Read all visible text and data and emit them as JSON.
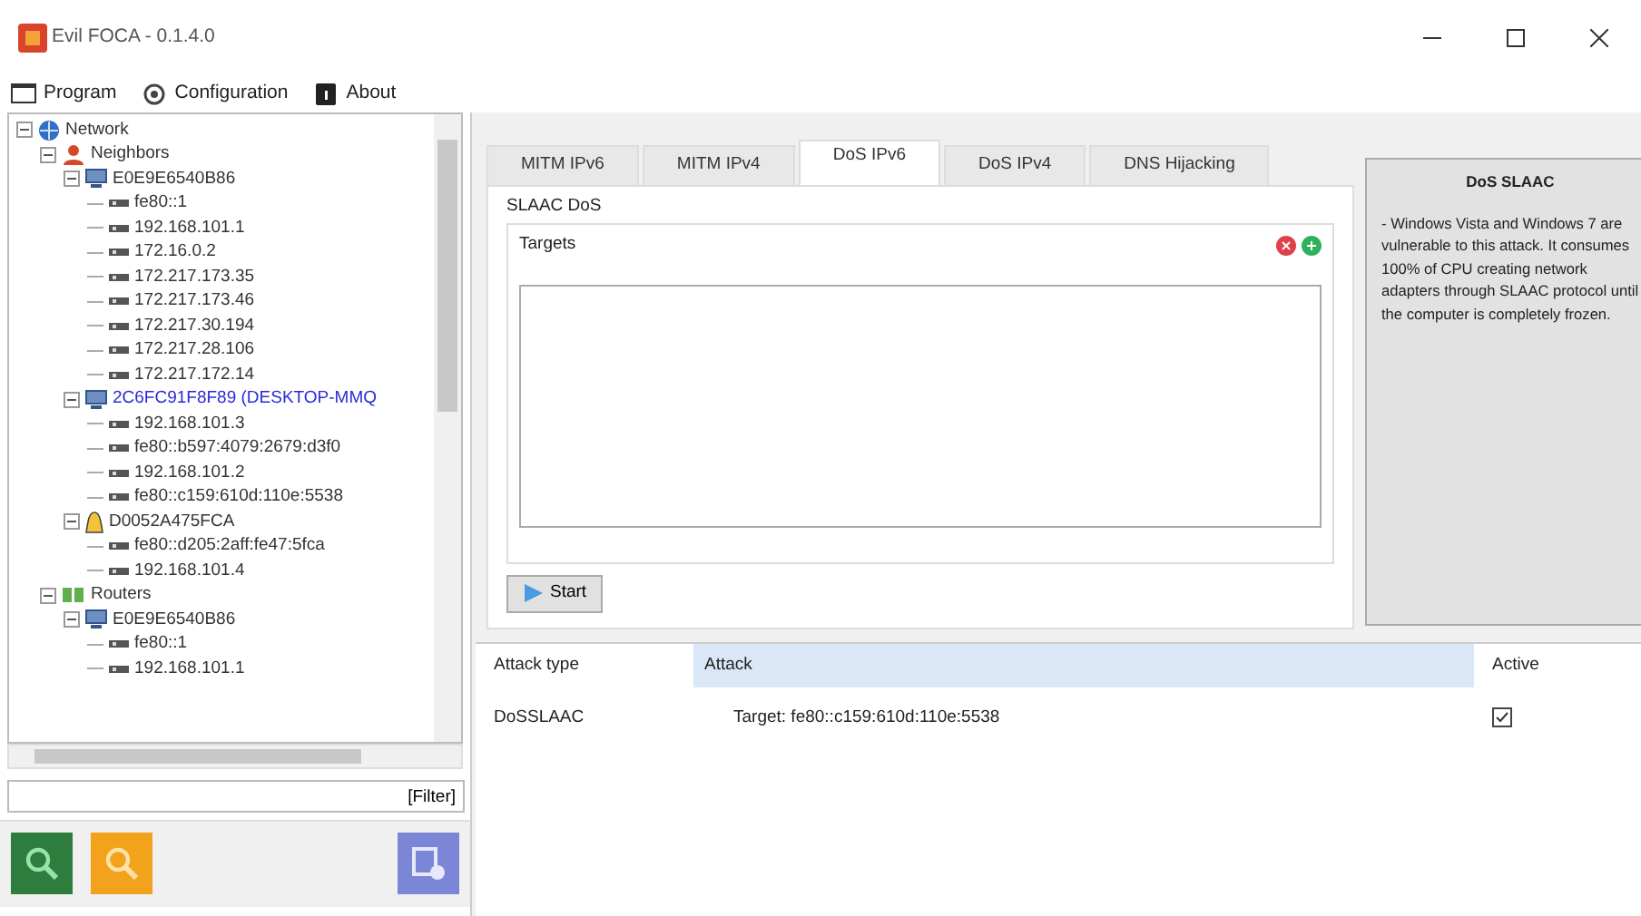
{
  "window": {
    "title": "Evil FOCA - 0.1.4.0"
  },
  "menu": [
    {
      "label": "Program",
      "kind": "program"
    },
    {
      "label": "Configuration",
      "kind": "config"
    },
    {
      "label": "About",
      "kind": "about"
    }
  ],
  "tree": [
    {
      "label": "Network",
      "kind": "network",
      "highlighted": false,
      "expanded": true,
      "children": [
        {
          "label": "Neighbors",
          "kind": "neighbors",
          "highlighted": false,
          "expanded": true,
          "children": [
            {
              "label": "E0E9E6540B86",
              "kind": "pc",
              "highlighted": false,
              "expanded": true,
              "children": [
                {
                  "label": "fe80::1",
                  "kind": "ip",
                  "highlighted": false
                },
                {
                  "label": "192.168.101.1",
                  "kind": "ip",
                  "highlighted": false
                },
                {
                  "label": "172.16.0.2",
                  "kind": "ip",
                  "highlighted": false
                },
                {
                  "label": "172.217.173.35",
                  "kind": "ip",
                  "highlighted": false
                },
                {
                  "label": "172.217.173.46",
                  "kind": "ip",
                  "highlighted": false
                },
                {
                  "label": "172.217.30.194",
                  "kind": "ip",
                  "highlighted": false
                },
                {
                  "label": "172.217.28.106",
                  "kind": "ip",
                  "highlighted": false
                },
                {
                  "label": "172.217.172.14",
                  "kind": "ip",
                  "highlighted": false
                }
              ]
            },
            {
              "label": "2C6FC91F8F89 (DESKTOP-MMQ",
              "kind": "pc",
              "highlighted": true,
              "expanded": true,
              "children": [
                {
                  "label": "192.168.101.3",
                  "kind": "ip",
                  "highlighted": false
                },
                {
                  "label": "fe80::b597:4079:2679:d3f0",
                  "kind": "ip",
                  "highlighted": false
                },
                {
                  "label": "192.168.101.2",
                  "kind": "ip",
                  "highlighted": false
                },
                {
                  "label": "fe80::c159:610d:110e:5538",
                  "kind": "ip",
                  "highlighted": false
                }
              ]
            },
            {
              "label": "D0052A475FCA",
              "kind": "linux",
              "highlighted": false,
              "expanded": true,
              "children": [
                {
                  "label": "fe80::d205:2aff:fe47:5fca",
                  "kind": "ip",
                  "highlighted": false
                },
                {
                  "label": "192.168.101.4",
                  "kind": "ip",
                  "highlighted": false
                }
              ]
            }
          ]
        },
        {
          "label": "Routers",
          "kind": "routers",
          "highlighted": false,
          "expanded": true,
          "children": [
            {
              "label": "E0E9E6540B86",
              "kind": "pc",
              "highlighted": false,
              "expanded": true,
              "children": [
                {
                  "label": "fe80::1",
                  "kind": "ip",
                  "highlighted": false
                },
                {
                  "label": "192.168.101.1",
                  "kind": "ip",
                  "highlighted": false
                }
              ]
            }
          ]
        }
      ]
    }
  ],
  "filter": {
    "value": "[Filter]"
  },
  "tools": [
    {
      "kind": "search-green"
    },
    {
      "kind": "search-orange"
    },
    {
      "kind": "monitor"
    }
  ],
  "tabs": [
    {
      "label": "MITM IPv6",
      "selected": false
    },
    {
      "label": "MITM IPv4",
      "selected": false
    },
    {
      "label": "DoS IPv6",
      "selected": true
    },
    {
      "label": "DoS IPv4",
      "selected": false
    },
    {
      "label": "DNS Hijacking",
      "selected": false
    }
  ],
  "attack_panel": {
    "group": "SLAAC DoS",
    "targets_label": "Targets",
    "start": "Start"
  },
  "info": {
    "title": "DoS SLAAC",
    "text": "- Windows Vista and Windows 7 are vulnerable to this attack. It consumes 100% of CPU creating network adapters through SLAAC protocol until the computer is completely frozen."
  },
  "table": {
    "columns": [
      "Attack type",
      "Attack",
      "Active"
    ],
    "rows": [
      {
        "type": "DoSSLAAC",
        "attack": "Target: fe80::c159:610d:110e:5538",
        "active": true
      }
    ]
  }
}
